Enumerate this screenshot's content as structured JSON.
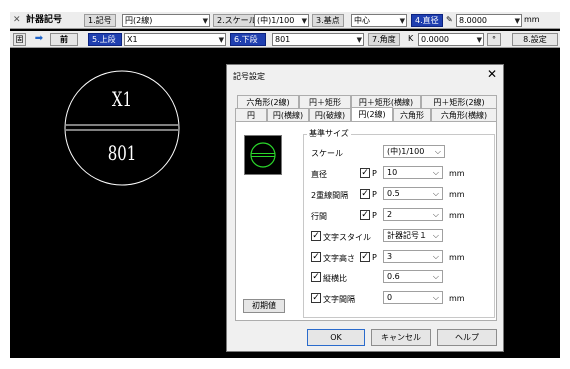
{
  "toolbar1": {
    "app_title": "計器記号",
    "kigo_label": "1.記号",
    "kigo_value": "円(2線)",
    "scale_label": "2.スケール",
    "scale_value": "(中)1/100",
    "base_label": "3.基点",
    "base_value": "中心",
    "diameter_label": "4.直径",
    "diameter_value": "8.0000",
    "diameter_unit": "mm"
  },
  "toolbar2": {
    "prev_label": "前",
    "upper_label": "5.上段",
    "upper_value": "X1",
    "lower_label": "6.下段",
    "lower_value": "801",
    "angle_label": "7.角度",
    "angle_prefix": "K",
    "angle_value": "0.0000",
    "degree_symbol": "°",
    "settings_button": "8.設定"
  },
  "drawing": {
    "upper_text": "X1",
    "lower_text": "801"
  },
  "dialog": {
    "title": "記号設定",
    "close_glyph": "✕",
    "tabs_row1": [
      "六角形(2線)",
      "円＋矩形",
      "円＋矩形(横線)",
      "円＋矩形(2線)"
    ],
    "tabs_row2": [
      "円",
      "円(横線)",
      "円(破線)",
      "円(2線)",
      "六角形",
      "六角形(横線)"
    ],
    "active_tab": "円(2線)",
    "group_title": "基準サイズ",
    "rows": [
      {
        "label": "スケール",
        "value": "(中)1/100",
        "p": "",
        "unit": ""
      },
      {
        "label": "直径",
        "value": "10",
        "p": "P",
        "unit": "mm"
      },
      {
        "label": "2重線間隔",
        "value": "0.5",
        "p": "P",
        "unit": "mm"
      },
      {
        "label": "行間",
        "value": "2",
        "p": "P",
        "unit": "mm"
      },
      {
        "label": "文字スタイル",
        "value": "計器記号１",
        "p": "",
        "unit": ""
      },
      {
        "label": "文字高さ",
        "value": "3",
        "p": "P",
        "unit": "mm"
      },
      {
        "label": "縦横比",
        "value": "0.6",
        "p": "",
        "unit": ""
      },
      {
        "label": "文字間隔",
        "value": "0",
        "p": "",
        "unit": "mm"
      }
    ],
    "init_button": "初期値",
    "ok_button": "OK",
    "cancel_button": "キャンセル",
    "help_button": "ヘルプ"
  }
}
